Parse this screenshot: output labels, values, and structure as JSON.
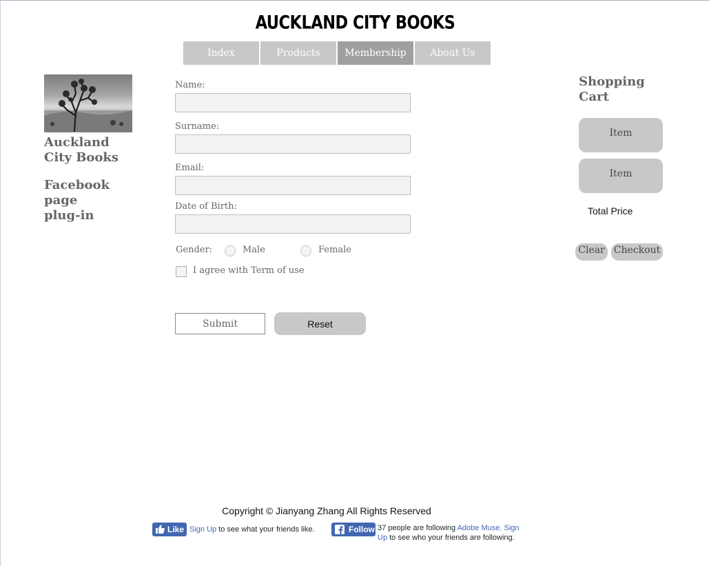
{
  "header": {
    "title": "AUCKLAND CITY BOOKS"
  },
  "nav": {
    "items": [
      {
        "label": "Index"
      },
      {
        "label": "Products"
      },
      {
        "label": "Membership"
      },
      {
        "label": "About Us"
      }
    ],
    "active": "Membership"
  },
  "sidebar": {
    "brand": "Auckland City Books",
    "facebook_plugin": "Facebook page plug-in"
  },
  "form": {
    "name_label": "Name:",
    "surname_label": "Surname:",
    "email_label": "Email:",
    "dob_label": "Date of Birth:",
    "gender_label": "Gender:",
    "male_label": "Male",
    "female_label": "Female",
    "agree_label": "I agree with Term of use",
    "submit_label": "Submit",
    "reset_label": "Reset"
  },
  "cart": {
    "title": "Shopping Cart",
    "items": [
      {
        "label": "Item"
      },
      {
        "label": "Item"
      }
    ],
    "total_label": "Total Price",
    "clear_label": "Clear",
    "checkout_label": "Checkout"
  },
  "footer": {
    "copyright": "Copyright © Jianyang Zhang All Rights Reserved",
    "like_label": "Like",
    "like_signup": "Sign Up",
    "like_text": "to see what your friends like.",
    "follow_label": "Follow",
    "follow_text": "37 people are following",
    "follow_page": "Adobe Muse.",
    "follow_signup": "Sign Up",
    "follow_text2": "to see who your friends are following."
  },
  "colors": {
    "nav_bg": "#c8c8c8",
    "nav_active_bg": "#a0a0a0",
    "button_gray": "#c8c8c8",
    "facebook_blue": "#4267b2"
  }
}
